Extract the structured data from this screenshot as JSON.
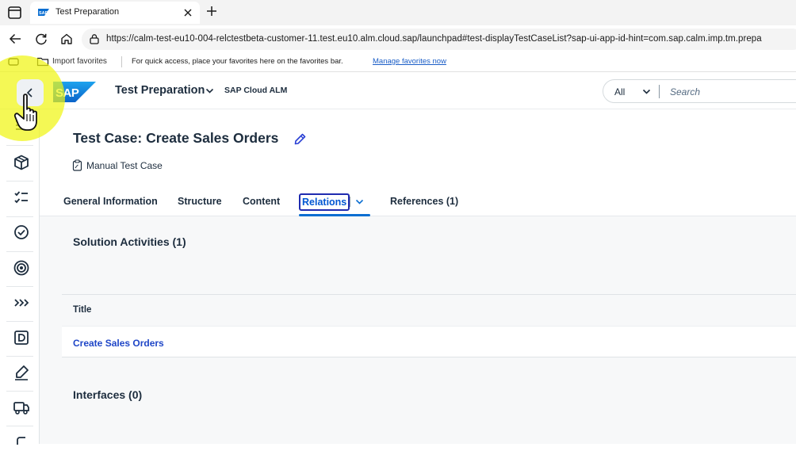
{
  "browser": {
    "tab_title": "Test Preparation",
    "url": "https://calm-test-eu10-004-relctestbeta-customer-11.test.eu10.alm.cloud.sap/launchpad#test-displayTestCaseList?sap-ui-app-id-hint=com.sap.calm.imp.tm.prepa",
    "favorites": {
      "import_label": "Import favorites",
      "hint": "For quick access, place your favorites here on the favorites bar.",
      "manage_link": "Manage favorites now"
    }
  },
  "shell": {
    "app_title": "Test Preparation",
    "product": "SAP Cloud ALM",
    "search": {
      "scope": "All",
      "placeholder": "Search"
    },
    "brand_color": "#0a6ed1"
  },
  "sidenav": {
    "items": [
      "list-icon",
      "box-icon",
      "checklist-icon",
      "verified-icon",
      "target-icon",
      "chevrons-right-icon",
      "display-icon",
      "signature-icon",
      "shipping-icon",
      "more-icon"
    ]
  },
  "object": {
    "title": "Test Case: Create Sales Orders",
    "type": "Manual Test Case"
  },
  "tabs": {
    "general": "General Information",
    "structure": "Structure",
    "content": "Content",
    "relations": "Relations",
    "references": "References (1)",
    "selected": "Relations"
  },
  "sections": {
    "solution_activities": {
      "title": "Solution Activities (1)",
      "columns": [
        "Title"
      ],
      "rows": [
        {
          "title": "Create Sales Orders"
        }
      ]
    },
    "interfaces": {
      "title": "Interfaces (0)"
    }
  }
}
